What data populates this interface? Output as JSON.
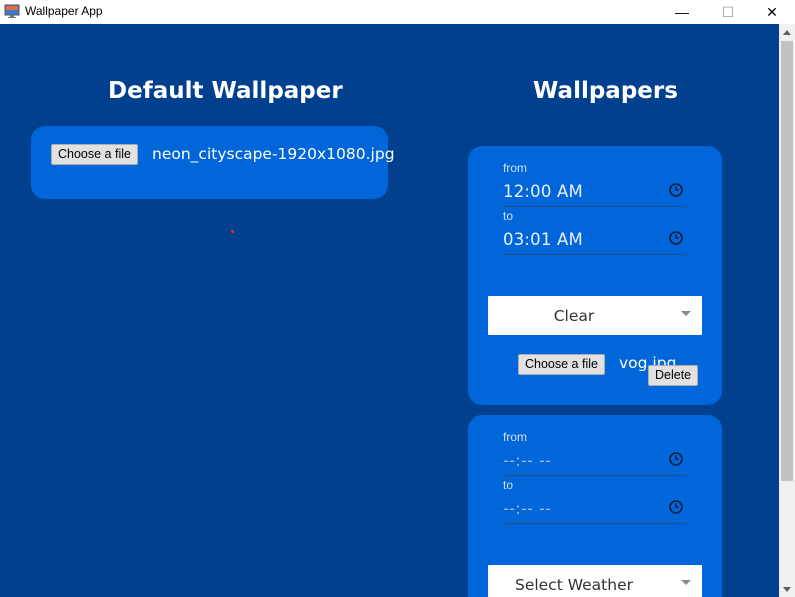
{
  "window": {
    "title": "Wallpaper App",
    "minimize_glyph": "—",
    "maximize_glyph": "☐",
    "close_glyph": "✕",
    "app_icon": "wallpaper-app-icon"
  },
  "default_section": {
    "heading": "Default Wallpaper",
    "file_button": "Choose a file",
    "file_name": "neon_cityscape-1920x1080.jpg"
  },
  "wallpapers_section": {
    "heading": "Wallpapers",
    "cards": [
      {
        "from_label": "from",
        "from_value": "12:00 AM",
        "to_label": "to",
        "to_value": "03:01 AM",
        "weather_value": "Clear",
        "file_button": "Choose a file",
        "file_name": "vog.jpg",
        "delete_button": "Delete"
      },
      {
        "from_label": "from",
        "from_value": "--:-- --",
        "to_label": "to",
        "to_value": "--:-- --",
        "weather_value": "Select Weather"
      }
    ]
  },
  "colors": {
    "background": "#00408f",
    "panel": "#0066da",
    "text": "#ffffff"
  }
}
